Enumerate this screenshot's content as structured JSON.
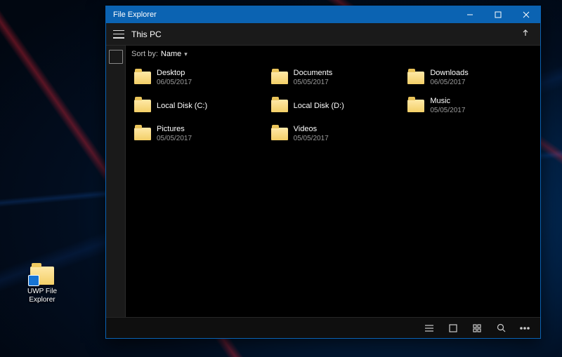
{
  "desktop": {
    "shortcut_line1": "UWP File",
    "shortcut_line2": "Explorer"
  },
  "window": {
    "title": "File Explorer",
    "location": "This PC",
    "sort": {
      "label": "Sort by:",
      "value": "Name"
    }
  },
  "items": [
    {
      "name": "Desktop",
      "date": "06/05/2017"
    },
    {
      "name": "Documents",
      "date": "05/05/2017"
    },
    {
      "name": "Downloads",
      "date": "06/05/2017"
    },
    {
      "name": "Local Disk (C:)",
      "date": ""
    },
    {
      "name": "Local Disk (D:)",
      "date": ""
    },
    {
      "name": "Music",
      "date": "05/05/2017"
    },
    {
      "name": "Pictures",
      "date": "05/05/2017"
    },
    {
      "name": "Videos",
      "date": "05/05/2017"
    }
  ],
  "icons": {
    "up": "up-arrow-icon",
    "min": "minimize-icon",
    "max": "maximize-icon",
    "close": "close-icon",
    "list": "list-view-icon",
    "tiles": "tiles-view-icon",
    "grid4": "grid-view-icon",
    "search": "search-icon",
    "more": "more-icon"
  }
}
